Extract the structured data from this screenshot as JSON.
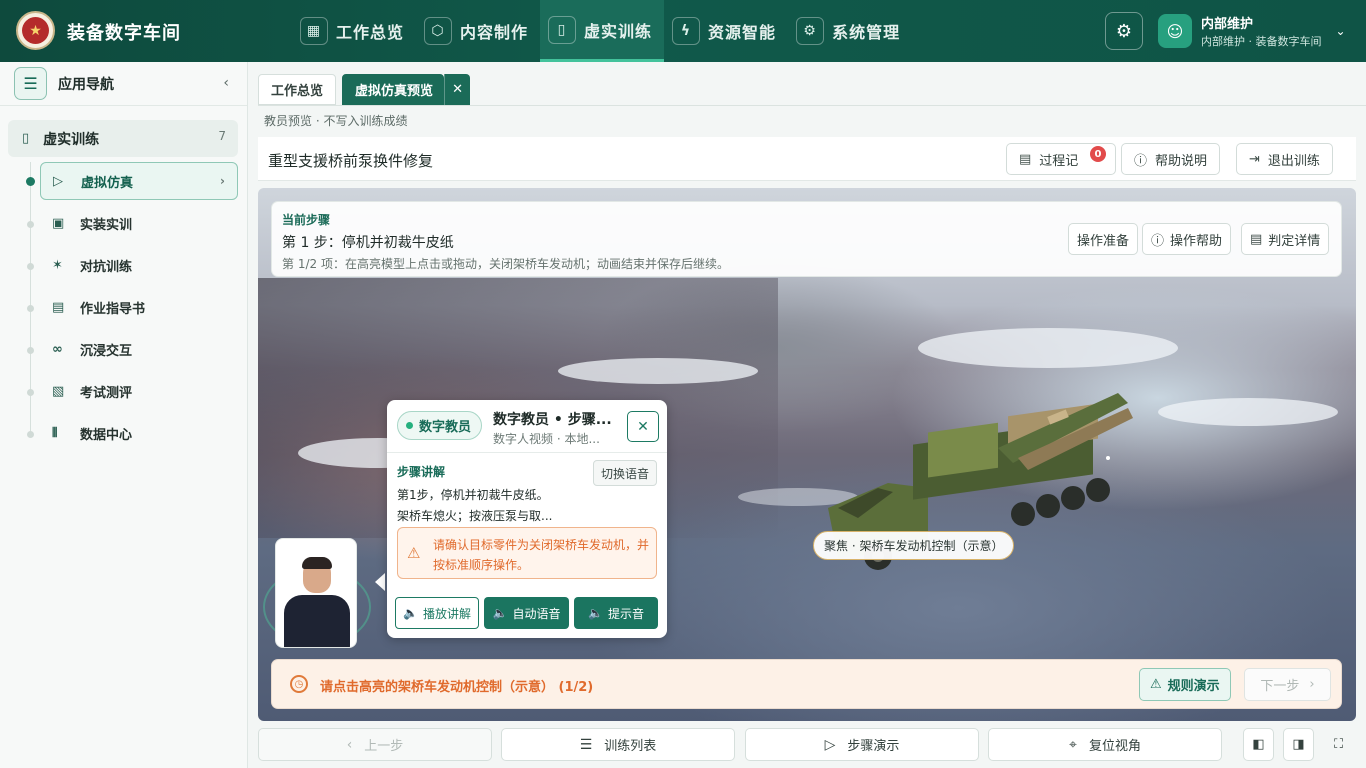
{
  "header": {
    "app_title": "装备数字车间",
    "nav": [
      {
        "label": "工作总览",
        "icon": "grid-icon"
      },
      {
        "label": "内容制作",
        "icon": "cube-icon"
      },
      {
        "label": "虚实训练",
        "icon": "book-icon",
        "active": true
      },
      {
        "label": "资源智能",
        "icon": "ai-icon"
      },
      {
        "label": "系统管理",
        "icon": "gear-icon"
      }
    ],
    "user": {
      "name": "内部维护",
      "subtitle": "内部维护 · 装备数字车间"
    }
  },
  "sidebar": {
    "title": "应用导航",
    "group": {
      "label": "虚实训练",
      "count": "7"
    },
    "items": [
      {
        "label": "虚拟仿真",
        "icon": "play-circle-icon",
        "active": true
      },
      {
        "label": "实装实训",
        "icon": "monitor-icon"
      },
      {
        "label": "对抗训练",
        "icon": "fight-icon"
      },
      {
        "label": "作业指导书",
        "icon": "document-icon"
      },
      {
        "label": "沉浸交互",
        "icon": "vr-icon"
      },
      {
        "label": "考试测评",
        "icon": "exam-icon"
      },
      {
        "label": "数据中心",
        "icon": "chart-icon"
      }
    ]
  },
  "tabs": [
    {
      "label": "工作总览"
    },
    {
      "label": "虚拟仿真预览",
      "active": true
    }
  ],
  "preview_note": "教员预览 · 不写入训练成绩",
  "page": {
    "title": "重型支援桥前泵换件修复",
    "buttons": {
      "record": "过程记",
      "record_count": "0",
      "help": "帮助说明",
      "exit": "退出训练"
    }
  },
  "step": {
    "label": "当前步骤",
    "name": "第 1 步：停机并初裁牛皮纸",
    "desc": "第 1/2 项：在高亮模型上点击或拖动，关闭架桥车发动机；动画结束并保存后继续。",
    "buttons": {
      "prepare": "操作准备",
      "help": "操作帮助",
      "judge": "判定详情"
    }
  },
  "focus_tag": "聚焦 · 架桥车发动机控制（示意）",
  "instructor": {
    "chip": "数字教员",
    "title": "数字教员 • 步骤...",
    "subtitle": "数字人视频 · 本地...",
    "section": "步骤讲解",
    "switch_voice": "切换语音",
    "line1": "第1步，停机并初裁牛皮纸。",
    "line2": "架桥车熄火；按液压泵与取...",
    "warning": "请确认目标零件为关闭架桥车发动机，并按标准顺序操作。",
    "buttons": {
      "play": "播放讲解",
      "auto_voice": "自动语音",
      "hint_sound": "提示音"
    }
  },
  "tip": {
    "text": "请点击高亮的架桥车发动机控制（示意） (1/2)",
    "rule_demo": "规则演示",
    "next": "下一步"
  },
  "bottom": {
    "prev": "上一步",
    "list": "训练列表",
    "demo": "步骤演示",
    "reset": "复位视角"
  },
  "colors": {
    "primary": "#1b6b58",
    "header": "#0e4a3d",
    "warning": "#e06a2c",
    "badge": "#e24b4b"
  }
}
